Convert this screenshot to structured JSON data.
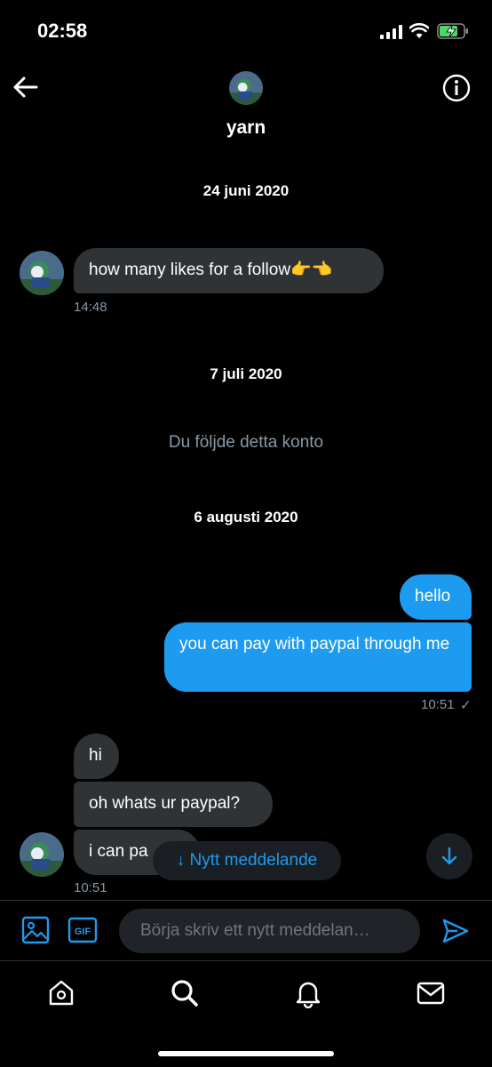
{
  "status_bar": {
    "time": "02:58"
  },
  "header": {
    "name": "yarn"
  },
  "dates": {
    "d1": "24 juni 2020",
    "d2": "7 juli 2020",
    "d3": "6 augusti 2020"
  },
  "system_note": "Du följde detta konto",
  "messages": {
    "m1": {
      "text": "how many likes for a follow👉👈",
      "time": "14:48"
    },
    "m2": {
      "text": "hello"
    },
    "m3": {
      "text": "you can pay with paypal through me",
      "time": "10:51",
      "receipt": "✓"
    },
    "m4": {
      "text": "hi"
    },
    "m5": {
      "text": "oh whats ur paypal?"
    },
    "m6": {
      "text": "i can pa",
      "time": "10:51"
    }
  },
  "new_message_pill": "↓ Nytt meddelande",
  "composer": {
    "placeholder": "Börja skriv ett nytt meddelan…",
    "gif_label": "GIF"
  },
  "colors": {
    "accent": "#1d9bf0",
    "bubble_incoming": "#2f3336",
    "background": "#000000"
  }
}
